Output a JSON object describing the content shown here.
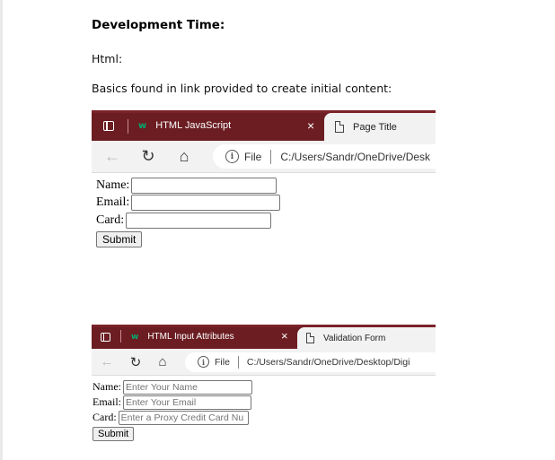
{
  "document": {
    "heading": "Development Time:",
    "line1": "Html:",
    "line2": "Basics found in link provided to create initial content:"
  },
  "screenshot1": {
    "active_tab": {
      "logo": "w",
      "title": "HTML JavaScript",
      "close": "×"
    },
    "inactive_tab": {
      "title": "Page Title"
    },
    "nav": {
      "back": "←",
      "reload": "↻",
      "home": "⌂"
    },
    "address": {
      "info": "i",
      "scheme": "File",
      "path": "C:/Users/Sandr/OneDrive/Desk"
    },
    "form": {
      "name_label": "Name:",
      "email_label": "Email:",
      "card_label": "Card:",
      "name_value": "",
      "email_value": "",
      "card_value": "",
      "submit": "Submit"
    }
  },
  "screenshot2": {
    "active_tab": {
      "logo": "w",
      "title": "HTML Input Attributes",
      "close": "×"
    },
    "inactive_tab": {
      "title": "Validation Form"
    },
    "nav": {
      "back": "←",
      "reload": "↻",
      "home": "⌂"
    },
    "address": {
      "info": "i",
      "scheme": "File",
      "path": "C:/Users/Sandr/OneDrive/Desktop/Digi"
    },
    "form": {
      "name_label": "Name:",
      "email_label": "Email:",
      "card_label": "Card:",
      "name_placeholder": "Enter Your Name",
      "email_placeholder": "Enter Your Email",
      "card_placeholder": "Enter a Proxy Credit Card Nu",
      "submit": "Submit"
    }
  },
  "colors": {
    "tab_bar": "#6b1d22",
    "w3_logo": "#04aa6d",
    "nav_bar": "#f3f2f2"
  },
  "icons": [
    "sidebar-toggle-icon",
    "w3schools-logo-icon",
    "close-icon",
    "page-icon",
    "back-arrow-icon",
    "reload-icon",
    "home-icon",
    "info-icon"
  ]
}
